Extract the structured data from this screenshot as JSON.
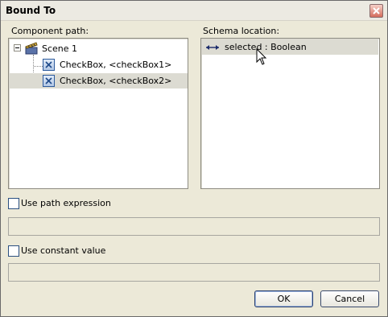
{
  "window": {
    "title": "Bound To"
  },
  "component_path": {
    "label": "Component path:",
    "tree": {
      "root": {
        "label": "Scene 1",
        "expander": "−"
      },
      "children": [
        {
          "label": "CheckBox, <checkBox1>",
          "selected": false
        },
        {
          "label": "CheckBox, <checkBox2>",
          "selected": true
        }
      ]
    }
  },
  "schema_location": {
    "label": "Schema location:",
    "items": [
      {
        "label": "selected : Boolean",
        "icon": "bidirectional-arrow-icon",
        "selected": true
      }
    ]
  },
  "use_path_expression": {
    "label": "Use path expression",
    "checked": false,
    "value": ""
  },
  "use_constant_value": {
    "label": "Use constant value",
    "checked": false,
    "value": ""
  },
  "buttons": {
    "ok": "OK",
    "cancel": "Cancel"
  }
}
